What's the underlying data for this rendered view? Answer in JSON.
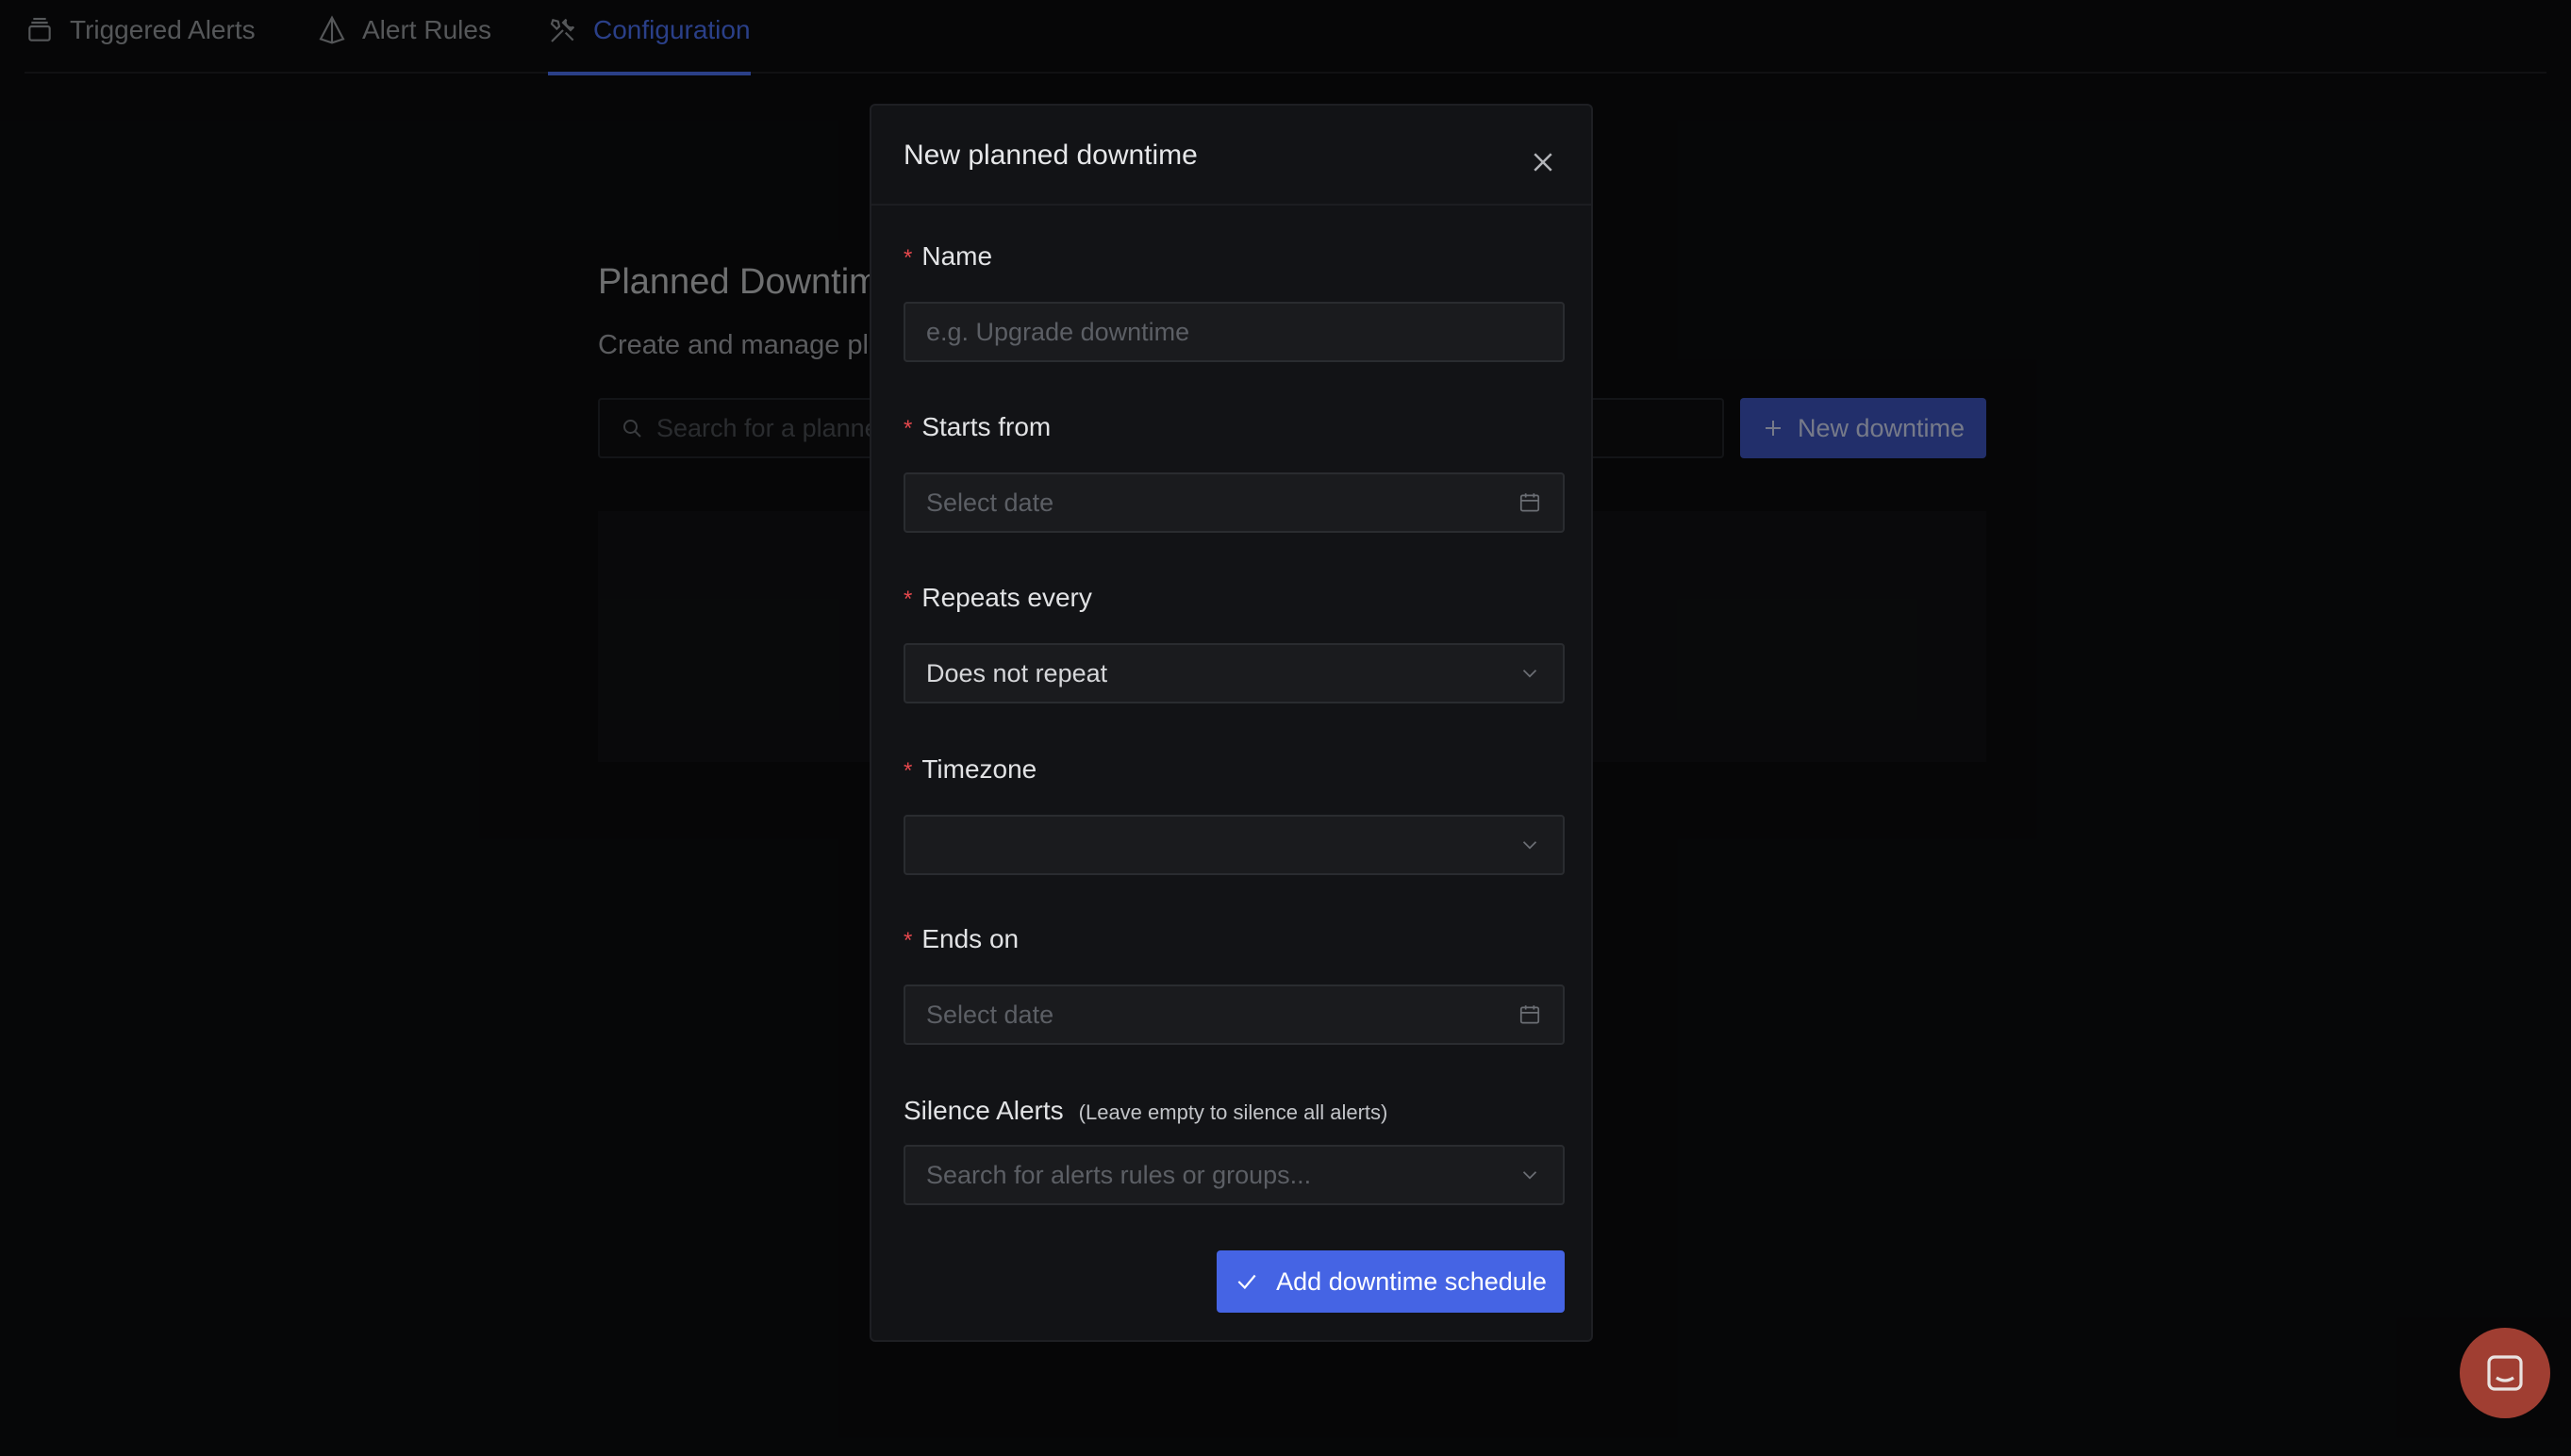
{
  "tabs": [
    {
      "label": "Triggered Alerts",
      "icon": "stack-icon"
    },
    {
      "label": "Alert Rules",
      "icon": "diamond-alert-icon"
    },
    {
      "label": "Configuration",
      "icon": "tools-icon",
      "active": true
    }
  ],
  "page": {
    "title": "Planned Downtim",
    "subtitle": "Create and manage pl",
    "search_placeholder": "Search for a planne",
    "new_button_label": "New downtime"
  },
  "modal": {
    "title": "New planned downtime",
    "fields": {
      "name": {
        "label": "Name",
        "required": true,
        "placeholder": "e.g. Upgrade downtime",
        "value": ""
      },
      "starts_from": {
        "label": "Starts from",
        "required": true,
        "placeholder": "Select date"
      },
      "repeats_every": {
        "label": "Repeats every",
        "required": true,
        "value": "Does not repeat"
      },
      "timezone": {
        "label": "Timezone",
        "required": true,
        "value": ""
      },
      "ends_on": {
        "label": "Ends on",
        "required": true,
        "placeholder": "Select date"
      },
      "silence_alerts": {
        "label": "Silence Alerts",
        "hint": "(Leave empty to silence all alerts)",
        "placeholder": "Search for alerts rules or groups..."
      }
    },
    "submit_label": "Add downtime schedule"
  },
  "colors": {
    "accent": "#4e74f8",
    "primary_button": "#4564e4",
    "required_marker": "#e5484d",
    "chat_launcher": "#a03e32"
  }
}
